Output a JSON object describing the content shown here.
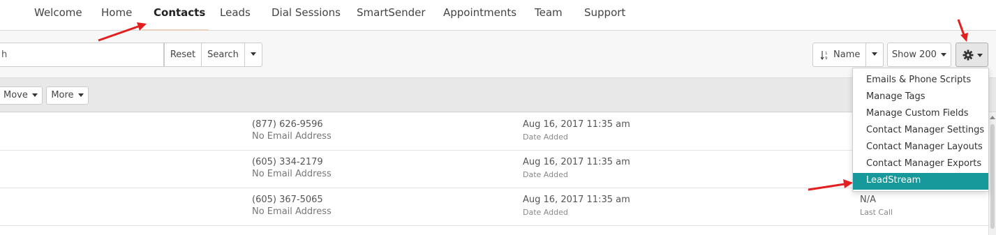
{
  "nav": {
    "items": [
      {
        "label": "Welcome"
      },
      {
        "label": "Home"
      },
      {
        "label": "Contacts"
      },
      {
        "label": "Leads"
      },
      {
        "label": "Dial Sessions"
      },
      {
        "label": "SmartSender"
      },
      {
        "label": "Appointments"
      },
      {
        "label": "Team"
      },
      {
        "label": "Support"
      }
    ],
    "active": "Contacts"
  },
  "search": {
    "value": "h",
    "reset_label": "Reset",
    "search_label": "Search"
  },
  "sort": {
    "label": "Name",
    "icon": "sort-alpha-icon"
  },
  "show": {
    "label": "Show 200"
  },
  "settings": {
    "icon": "gear-icon"
  },
  "actions": {
    "move_label": "Move",
    "more_label": "More"
  },
  "rows": [
    {
      "phone": "(877) 626-9596",
      "email": "No Email Address",
      "date": "Aug 16, 2017 11:35 am",
      "date_label": "Date Added",
      "last_call": "",
      "last_call_label": ""
    },
    {
      "phone": "(605) 334-2179",
      "email": "No Email Address",
      "date": "Aug 16, 2017 11:35 am",
      "date_label": "Date Added",
      "last_call": "",
      "last_call_label": ""
    },
    {
      "phone": "(605) 367-5065",
      "email": "No Email Address",
      "date": "Aug 16, 2017 11:35 am",
      "date_label": "Date Added",
      "last_call": "N/A",
      "last_call_label": "Last Call"
    }
  ],
  "dropdown": {
    "items": [
      {
        "label": "Emails & Phone Scripts"
      },
      {
        "label": "Manage Tags"
      },
      {
        "label": "Manage Custom Fields"
      },
      {
        "label": "Contact Manager Settings"
      },
      {
        "label": "Contact Manager Layouts"
      },
      {
        "label": "Contact Manager Exports"
      },
      {
        "label": "LeadStream"
      }
    ],
    "active": "LeadStream"
  },
  "colors": {
    "accent": "#17999b",
    "annotation": "#e41e1e",
    "active_tab_underline": "#e9d3c0"
  }
}
